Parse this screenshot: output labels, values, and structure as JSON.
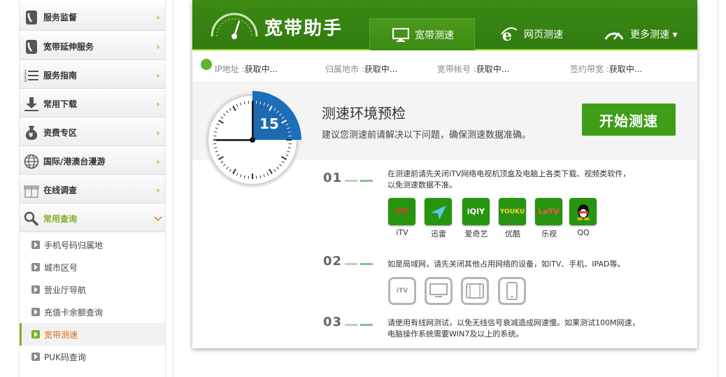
{
  "sidebar": {
    "categories": [
      {
        "label": "服务监督",
        "icon": "phone-icon"
      },
      {
        "label": "宽带延伸服务",
        "icon": "phone-icon"
      },
      {
        "label": "服务指南",
        "icon": "list-icon"
      },
      {
        "label": "常用下载",
        "icon": "download-icon"
      },
      {
        "label": "资费专区",
        "icon": "money-bag-icon"
      },
      {
        "label": "国际/港澳台漫游",
        "icon": "globe-icon"
      },
      {
        "label": "在线调查",
        "icon": "gift-icon"
      },
      {
        "label": "常用查询",
        "icon": "magnifier-icon"
      }
    ],
    "subitems": [
      {
        "label": "手机号码归属地"
      },
      {
        "label": "城市区号"
      },
      {
        "label": "营业厅导航"
      },
      {
        "label": "充值卡余额查询"
      },
      {
        "label": "宽带测速"
      },
      {
        "label": "PUK码查询"
      }
    ],
    "arrow_right": "›",
    "arrow_down": "⌄"
  },
  "widget": {
    "title": "宽带助手",
    "tabs": [
      {
        "label": "宽带测速"
      },
      {
        "label": "网页测速"
      },
      {
        "label": "更多测速 ▾"
      }
    ],
    "info": [
      {
        "label": "IP地址 :",
        "value": "获取中..."
      },
      {
        "label": "归属地市 :",
        "value": "获取中..."
      },
      {
        "label": "宽带帐号 :",
        "value": "获取中..."
      },
      {
        "label": "签约带宽 :",
        "value": "获取中..."
      }
    ],
    "precheck": {
      "title": "测速环境预检",
      "subtitle": "建议您测速前请解决以下问题，确保测速数据准确。",
      "start_label": "开始测速",
      "timer": "15"
    },
    "steps": [
      {
        "num": "01",
        "text_line1": "在测速前请先关闭iTV网络电视机顶盒及电脑上各类下载、视频类软件，",
        "text_line2": "以免测速数据不准。"
      },
      {
        "num": "02",
        "text_line1": "如是局域网，请先关闭其他占用网络的设备，如iTV、手机、IPAD等。",
        "text_line2": ""
      },
      {
        "num": "03",
        "text_line1": "请使用有线网测试，以免无线信号衰减造成网速慢。如果测试100M网速，",
        "text_line2": "电脑操作系统需要WIN7及以上的系统。"
      }
    ],
    "apps": [
      {
        "caption": "iTV",
        "glyph": "iTV"
      },
      {
        "caption": "迅雷",
        "glyph": ""
      },
      {
        "caption": "爱奇艺",
        "glyph": "iQIY"
      },
      {
        "caption": "优酷",
        "glyph": "YOUKU"
      },
      {
        "caption": "乐视",
        "glyph": "LeTV"
      },
      {
        "caption": "QQ",
        "glyph": ""
      }
    ],
    "devices": [
      {
        "glyph": "iTV"
      }
    ]
  },
  "colors": {
    "banner": "#3a8614",
    "accent": "#7fb024",
    "start_button": "#3f9e18",
    "active_text": "#e06c12"
  }
}
